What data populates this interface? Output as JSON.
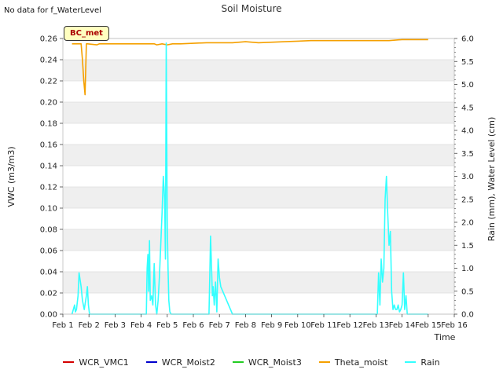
{
  "header": {
    "no_data_note": "No data for f_WaterLevel",
    "title": "Soil Moisture",
    "site_badge": "BC_met"
  },
  "colors": {
    "WCR_VMC1": "#d40000",
    "WCR_Moist2": "#0000cc",
    "WCR_Moist3": "#22cc22",
    "Theta_moist": "#f5a000",
    "Rain": "#33ffff",
    "band": "#efefef",
    "grid": "#dcdcdc"
  },
  "chart_data": {
    "type": "line",
    "title": "Soil Moisture",
    "xlabel": "Time",
    "ylabel": "VWC (m3/m3)",
    "y2label": "Rain (mm), Water Level (cm)",
    "xlim": [
      1,
      16
    ],
    "ylim": [
      0,
      0.26
    ],
    "y2lim": [
      0,
      6
    ],
    "x_tick_values": [
      1,
      2,
      3,
      4,
      5,
      6,
      7,
      8,
      9,
      10,
      11,
      12,
      13,
      14,
      15,
      16
    ],
    "x_tick_labels": [
      "Feb 1",
      "Feb 2",
      "Feb 3",
      "Feb 4",
      "Feb 5",
      "Feb 6",
      "Feb 7",
      "Feb 8",
      "Feb 9",
      "Feb 10",
      "Feb 11",
      "Feb 12",
      "Feb 13",
      "Feb 14",
      "Feb 15",
      "Feb 16"
    ],
    "y_tick_values": [
      0,
      0.02,
      0.04,
      0.06,
      0.08,
      0.1,
      0.12,
      0.14,
      0.16,
      0.18,
      0.2,
      0.22,
      0.24,
      0.26
    ],
    "y_tick_labels": [
      "0.00",
      "0.02",
      "0.04",
      "0.06",
      "0.08",
      "0.10",
      "0.12",
      "0.14",
      "0.16",
      "0.18",
      "0.20",
      "0.22",
      "0.24",
      "0.26"
    ],
    "y2_tick_values": [
      0,
      0.5,
      1,
      1.5,
      2,
      2.5,
      3,
      3.5,
      4,
      4.5,
      5,
      5.5,
      6
    ],
    "y2_tick_labels": [
      "0.0",
      "0.5",
      "1.0",
      "1.5",
      "2.0",
      "2.5",
      "3.0",
      "3.5",
      "4.0",
      "4.5",
      "5.0",
      "5.5",
      "6.0"
    ],
    "grid": true,
    "legend_position": "bottom",
    "series": [
      {
        "name": "WCR_VMC1",
        "axis": "left",
        "x": [],
        "y": []
      },
      {
        "name": "WCR_Moist2",
        "axis": "left",
        "x": [],
        "y": []
      },
      {
        "name": "WCR_Moist3",
        "axis": "left",
        "x": [],
        "y": []
      },
      {
        "name": "Theta_moist",
        "axis": "left",
        "x": [
          1.35,
          1.7,
          1.75,
          1.8,
          1.85,
          1.9,
          1.95,
          2.3,
          2.4,
          4.5,
          4.6,
          4.8,
          5.0,
          5.2,
          5.5,
          6.5,
          7.5,
          8.0,
          8.5,
          9.5,
          10.5,
          11.5,
          12.5,
          13.0,
          13.5,
          14.0,
          15.0
        ],
        "y": [
          0.255,
          0.255,
          0.24,
          0.22,
          0.207,
          0.255,
          0.255,
          0.254,
          0.255,
          0.255,
          0.254,
          0.255,
          0.254,
          0.255,
          0.255,
          0.256,
          0.256,
          0.257,
          0.256,
          0.257,
          0.258,
          0.258,
          0.258,
          0.258,
          0.258,
          0.259,
          0.259
        ]
      },
      {
        "name": "Rain",
        "axis": "right",
        "x": [
          1.35,
          1.45,
          1.48,
          1.52,
          1.58,
          1.62,
          1.7,
          1.75,
          1.82,
          1.9,
          1.94,
          1.98,
          2.02,
          2.1,
          4.2,
          4.23,
          4.26,
          4.29,
          4.32,
          4.35,
          4.4,
          4.45,
          4.5,
          4.55,
          4.6,
          4.65,
          4.7,
          4.75,
          4.8,
          4.85,
          4.9,
          4.93,
          4.96,
          5.0,
          5.03,
          5.06,
          5.1,
          5.15,
          5.25,
          6.6,
          6.63,
          6.66,
          6.7,
          6.73,
          6.76,
          6.8,
          6.85,
          6.9,
          6.95,
          7.0,
          7.05,
          7.5,
          13.05,
          13.1,
          13.15,
          13.2,
          13.25,
          13.3,
          13.35,
          13.4,
          13.45,
          13.5,
          13.55,
          13.6,
          13.65,
          13.7,
          13.75,
          13.8,
          13.85,
          13.9,
          13.95,
          14.0,
          14.05,
          14.1,
          14.15,
          14.2,
          14.3
        ],
        "y": [
          0.0,
          0.2,
          0.05,
          0.1,
          0.4,
          0.9,
          0.6,
          0.3,
          0.1,
          0.4,
          0.6,
          0.2,
          0.0,
          0.0,
          0.0,
          1.0,
          1.3,
          0.5,
          1.6,
          0.3,
          0.4,
          0.2,
          1.1,
          0.2,
          0.0,
          0.3,
          0.8,
          1.5,
          2.2,
          3.0,
          2.5,
          1.2,
          5.9,
          2.0,
          1.0,
          0.3,
          0.05,
          0.0,
          0.0,
          0.0,
          0.8,
          1.7,
          1.0,
          0.4,
          0.6,
          0.2,
          0.7,
          0.05,
          1.2,
          0.8,
          0.6,
          0.0,
          0.0,
          0.9,
          0.2,
          1.2,
          0.7,
          1.0,
          2.5,
          3.0,
          2.2,
          1.5,
          1.8,
          0.5,
          0.1,
          0.2,
          0.1,
          0.1,
          0.2,
          0.05,
          0.1,
          0.2,
          0.9,
          0.1,
          0.4,
          0.0,
          0.0
        ]
      }
    ]
  }
}
